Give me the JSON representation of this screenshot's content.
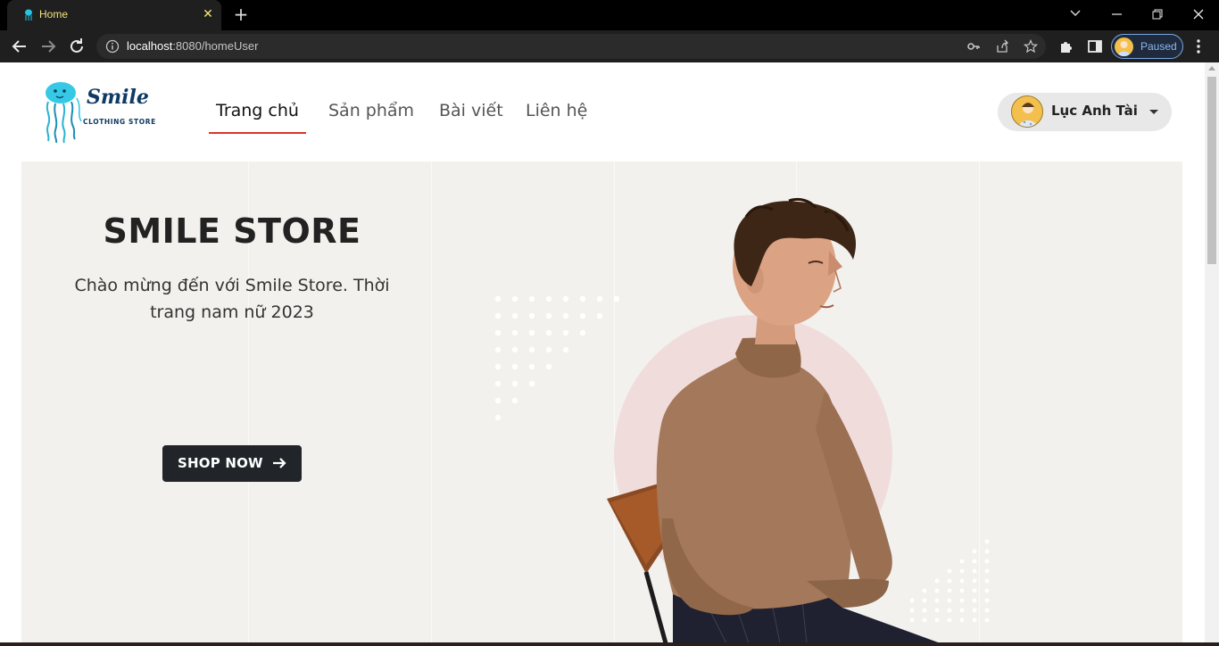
{
  "browser": {
    "tab_title": "Home",
    "url_host": "localhost",
    "url_rest": ":8080/homeUser",
    "profile_status": "Paused"
  },
  "site": {
    "logo_name": "Smile",
    "logo_tagline": "CLOTHING STORE",
    "nav": [
      {
        "label": "Trang chủ",
        "active": true
      },
      {
        "label": "Sản phẩm",
        "active": false
      },
      {
        "label": "Bài viết",
        "active": false
      },
      {
        "label": "Liên hệ",
        "active": false
      }
    ],
    "user_name": "Lục Anh Tài"
  },
  "hero": {
    "title": "SMILE STORE",
    "subtitle": "Chào mừng đến với Smile Store. Thời trang nam nữ 2023",
    "cta_label": "SHOP NOW"
  },
  "colors": {
    "accent_underline": "#d9362b",
    "hero_bg": "#f2f1ee",
    "button_bg": "#212529",
    "circle_pink": "#f1dcdc",
    "sweater": "#a4785a"
  },
  "icons": [
    "back-icon",
    "forward-icon",
    "reload-icon",
    "info-icon",
    "key-icon",
    "share-icon",
    "star-icon",
    "extensions-icon",
    "side-panel-icon",
    "more-icon",
    "arrow-right-icon",
    "caret-down-icon"
  ]
}
